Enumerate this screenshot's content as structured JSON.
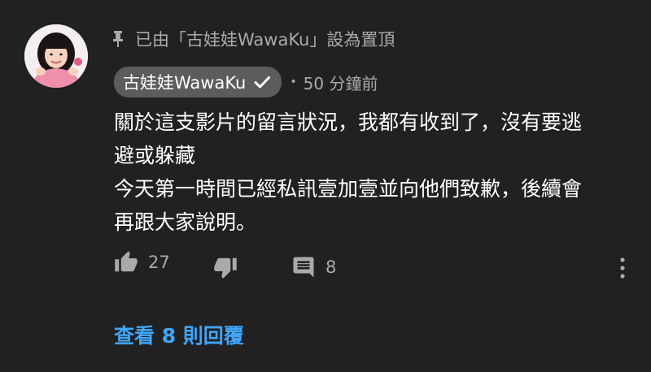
{
  "comment": {
    "pinned_text": "已由「古娃娃WawaKu」設為置頂",
    "author": "古娃娃WawaKu",
    "separator": "•",
    "time": "50 分鐘前",
    "body_lines": [
      "關於這支影片的留言狀況，我都有收到了，沒有要逃",
      "避或躲藏",
      "今天第一時間已經私訊壹加壹並向他們致歉，後續會",
      "再跟大家說明。"
    ],
    "likes": "27",
    "replies_count": "8",
    "view_replies_label": "查看 8 則回覆"
  },
  "icons": {
    "pin": "pin-icon",
    "verified": "check-icon",
    "like": "thumb-up-icon",
    "dislike": "thumb-down-icon",
    "reply": "comment-icon",
    "more": "more-vert-icon"
  },
  "colors": {
    "background": "#212121",
    "text_primary": "#ffffff",
    "text_secondary": "#aaaaaa",
    "author_chip": "#5c5c5c",
    "link": "#3ea6ff"
  }
}
